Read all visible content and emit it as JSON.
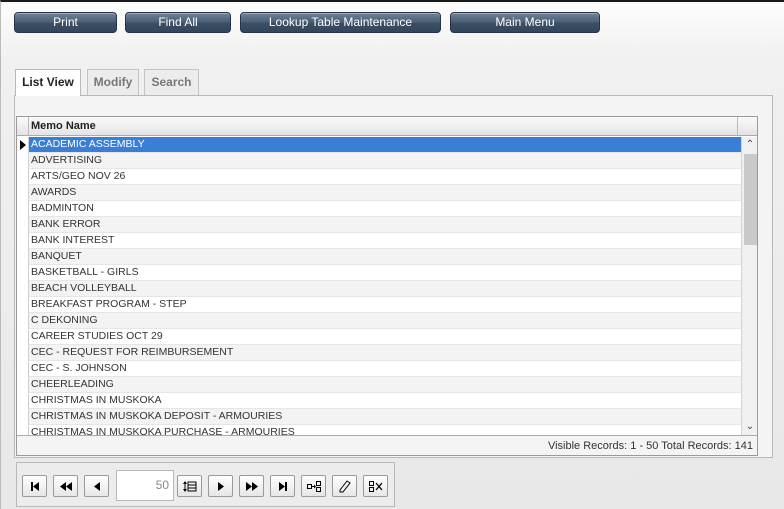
{
  "toolbar": {
    "print_label": "Print",
    "find_all_label": "Find All",
    "lookup_label": "Lookup Table Maintenance",
    "main_menu_label": "Main Menu"
  },
  "tabs": {
    "list_view": "List View",
    "modify": "Modify",
    "search": "Search"
  },
  "grid": {
    "column_header": "Memo Name",
    "rows": [
      "ACADEMIC ASSEMBLY",
      "ADVERTISING",
      "ARTS/GEO NOV 26",
      "AWARDS",
      "BADMINTON",
      "BANK ERROR",
      "BANK INTEREST",
      "BANQUET",
      "BASKETBALL - GIRLS",
      "BEACH VOLLEYBALL",
      "BREAKFAST PROGRAM - STEP",
      "C DEKONING",
      "CAREER STUDIES OCT 29",
      "CEC - REQUEST FOR REIMBURSEMENT",
      "CEC - S. JOHNSON",
      "CHEERLEADING",
      "CHRISTMAS IN MUSKOKA",
      "CHRISTMAS IN MUSKOKA DEPOSIT - ARMOURIES",
      "CHRISTMAS IN MUSKOKA PURCHASE - ARMOURIES"
    ],
    "selected_index": 0,
    "status": "Visible Records: 1 - 50 Total Records: 141"
  },
  "navigator": {
    "page_size": "50"
  },
  "icons": {
    "first": "first-record-icon",
    "prev_page": "previous-page-icon",
    "prev": "previous-record-icon",
    "page_size": "page-size-icon",
    "next": "next-record-icon",
    "next_page": "next-page-icon",
    "last": "last-record-icon",
    "goto": "go-to-record-icon",
    "edit": "edit-icon",
    "delete": "delete-icon"
  },
  "colors": {
    "button": "#4d6178",
    "selected_row": "#3a7fd5"
  }
}
